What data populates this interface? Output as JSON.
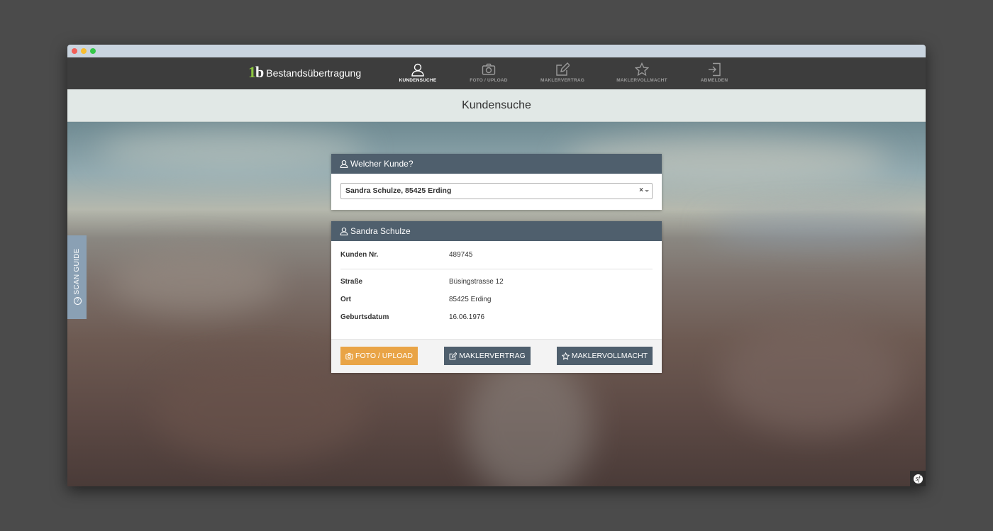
{
  "brand": {
    "logo": "1b",
    "name": "Bestandsübertragung"
  },
  "nav": {
    "items": [
      {
        "label": "KUNDENSUCHE",
        "icon": "user-icon",
        "active": true
      },
      {
        "label": "FOTO / UPLOAD",
        "icon": "camera-icon",
        "active": false
      },
      {
        "label": "MAKLERVERTRAG",
        "icon": "edit-icon",
        "active": false
      },
      {
        "label": "MAKLERVOLLMACHT",
        "icon": "star-icon",
        "active": false
      },
      {
        "label": "ABMELDEN",
        "icon": "logout-icon",
        "active": false
      }
    ]
  },
  "page_title": "Kundensuche",
  "scan_guide": {
    "label": "SCAN GUIDE",
    "icon": "help-circle-icon"
  },
  "search_panel": {
    "title": "Welcher Kunde?",
    "select_value": "Sandra Schulze, 85425 Erding",
    "clear_symbol": "×"
  },
  "customer_panel": {
    "title": "Sandra Schulze",
    "fields": [
      {
        "label": "Kunden Nr.",
        "value": "489745"
      },
      {
        "label": "Straße",
        "value": "Büsingstrasse 12"
      },
      {
        "label": "Ort",
        "value": "85425 Erding"
      },
      {
        "label": "Geburtsdatum",
        "value": "16.06.1976"
      }
    ],
    "buttons": {
      "foto": "FOTO / UPLOAD",
      "maklervertrag": "MAKLERVERTRAG",
      "maklervollmacht": "MAKLERVOLLMACHT"
    }
  },
  "colors": {
    "navbar": "#3d3d3d",
    "panel_header": "#4f5f6d",
    "accent_orange": "#e9a446",
    "brand_green": "#8cc63f",
    "subheader": "#e1e8e6"
  }
}
